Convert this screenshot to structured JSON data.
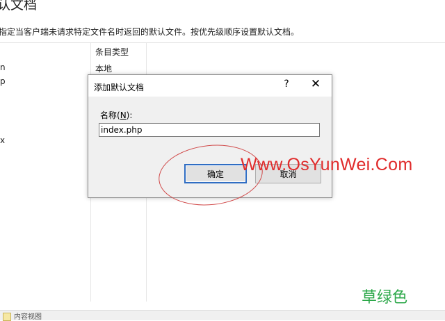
{
  "page": {
    "title": "认文档",
    "description": "指定当客户端未请求特定文件名时返回的默认文件。按优先级顺序设置默认文档。",
    "column_header": "条目类型",
    "entry_type_value": "本地",
    "name_fragments": [
      "n",
      "p",
      "x"
    ]
  },
  "dialog": {
    "title": "添加默认文档",
    "help_glyph": "?",
    "close_glyph": "✕",
    "label_prefix": "名称(",
    "label_accel": "N",
    "label_suffix": "):",
    "input_value": "index.php",
    "ok_label": "确定",
    "cancel_label": "取消"
  },
  "watermark": "Www.OsYunWei.Com",
  "corner_mark": "草绿色",
  "bottom_bar": {
    "text": "内容视图"
  }
}
